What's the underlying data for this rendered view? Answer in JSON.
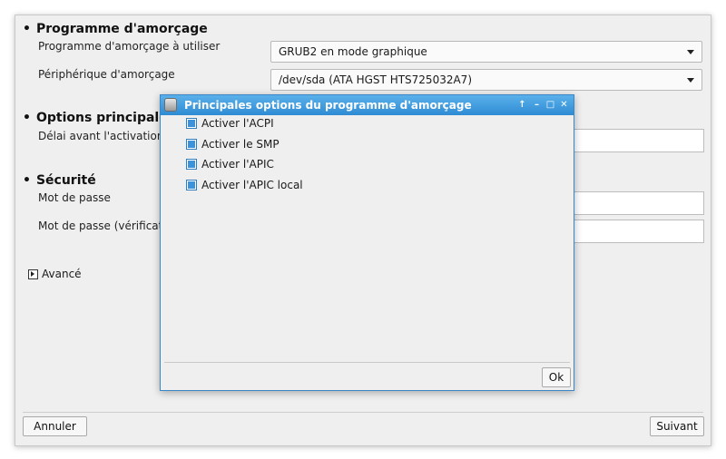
{
  "sections": {
    "bootloader": {
      "title": "Programme d'amorçage",
      "bootloader_label": "Programme d'amorçage à utiliser",
      "bootloader_value": "GRUB2 en mode graphique",
      "device_label": "Périphérique d'amorçage",
      "device_value": "/dev/sda (ATA HGST HTS725032A7)"
    },
    "main_options": {
      "title": "Options principales",
      "delay_label": "Délai avant l'activation o"
    },
    "security": {
      "title": "Sécurité",
      "password_label": "Mot de passe",
      "password_verify_label": "Mot de passe (vérificatio"
    }
  },
  "advanced_label": "Avancé",
  "footer": {
    "cancel": "Annuler",
    "next": "Suivant"
  },
  "dialog": {
    "title": "Principales options du programme d'amorçage",
    "options": [
      {
        "label": "Activer l'ACPI",
        "checked": true
      },
      {
        "label": "Activer le SMP",
        "checked": true
      },
      {
        "label": "Activer l'APIC",
        "checked": true
      },
      {
        "label": "Activer l'APIC local",
        "checked": true
      }
    ],
    "ok": "Ok",
    "titlebar_buttons": [
      "up-arrow-icon",
      "minimize-icon",
      "maximize-icon",
      "close-icon"
    ]
  },
  "colors": {
    "accent": "#3a93db",
    "titlebar": "#2e8bd3"
  }
}
